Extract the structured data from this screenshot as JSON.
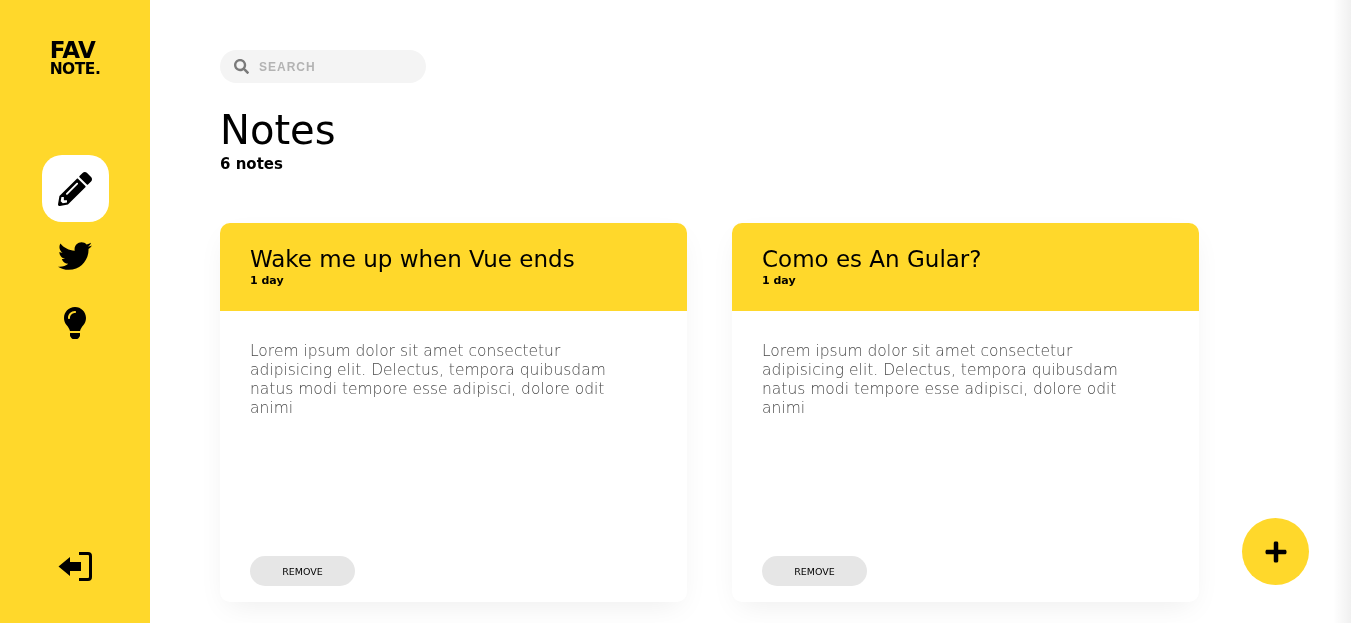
{
  "logo": {
    "lines": [
      "FAV",
      "NOTE."
    ]
  },
  "sidebar": {
    "items": [
      {
        "kind": "pencil",
        "selected": true
      },
      {
        "kind": "bird",
        "selected": false
      },
      {
        "kind": "bulb",
        "selected": false
      }
    ]
  },
  "search": {
    "placeholder": "SEARCH"
  },
  "header": {
    "title": "Notes",
    "count": "6 notes"
  },
  "notes": [
    {
      "title": "Wake me up when Vue ends",
      "date": "1 day",
      "content": "Lorem ipsum dolor sit amet consectetur adipisicing elit. Delectus, tempora quibusdam natus modi tempore esse adipisci, dolore odit animi",
      "button": "REMOVE"
    },
    {
      "title": "Como es An Gular?",
      "date": "1 day",
      "content": "Lorem ipsum dolor sit amet consectetur adipisicing elit. Delectus, tempora quibusdam natus modi tempore esse adipisci, dolore odit animi",
      "button": "REMOVE"
    }
  ]
}
